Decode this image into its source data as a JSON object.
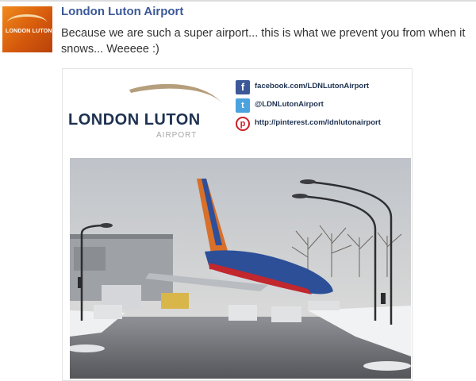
{
  "post": {
    "author": "London Luton Airport",
    "status_text": "Because we are such a super airport... this is what we prevent you from when it snows... Weeeee :)"
  },
  "avatar": {
    "logo_text": "LONDON LUTON"
  },
  "banner": {
    "logo_main": "LONDON LUTON",
    "logo_sub": "AIRPORT",
    "social": [
      {
        "icon": "facebook-icon",
        "text": "facebook.com/LDNLutonAirport"
      },
      {
        "icon": "twitter-icon",
        "text": "@LDNLutonAirport"
      },
      {
        "icon": "pinterest-icon",
        "text": "http://pinterest.com/ldnlutonairport"
      }
    ]
  },
  "colors": {
    "author_link": "#3b5998",
    "logo_navy": "#1d3150",
    "brand_orange": "#e8731a"
  }
}
